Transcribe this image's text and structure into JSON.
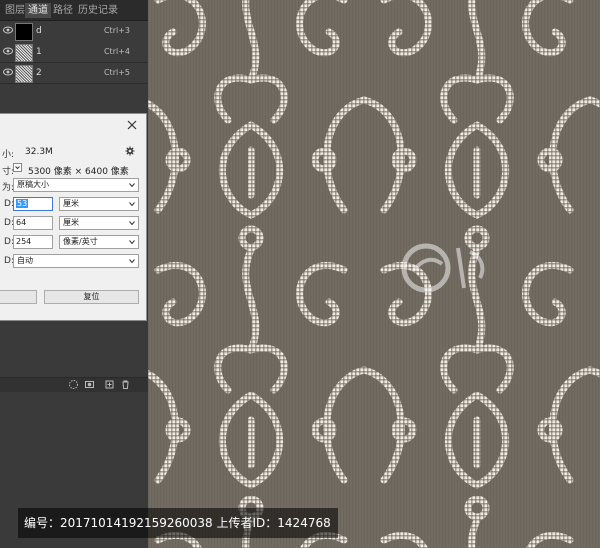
{
  "tabs": [
    "图层",
    "通道",
    "路径",
    "历史记录"
  ],
  "channels": [
    {
      "name": "d",
      "shortcut": "Ctrl+3"
    },
    {
      "name": "1",
      "shortcut": "Ctrl+4"
    },
    {
      "name": "2",
      "shortcut": "Ctrl+5"
    }
  ],
  "dialog": {
    "size_label": "小:",
    "size_value": "32.3M",
    "dim_label": "寸:",
    "dim_value": "5300 像素 × 6400 像素",
    "fit_label": "为:",
    "fit_value": "原稿大小",
    "width_label": "D:",
    "width_value": "53",
    "width_unit": "厘米",
    "height_label": "D:",
    "height_value": "64",
    "height_unit": "厘米",
    "res_label": "D:",
    "res_value": "254",
    "res_unit": "像素/英寸",
    "resample_label": "D:",
    "resample_value": "自动",
    "reset_label": "复位"
  },
  "caption": "编号：20171014192159260038 上传者ID：1424768",
  "colors": {
    "pattern_bg": "#716b62",
    "pattern_fg": "#f1ebe1"
  }
}
